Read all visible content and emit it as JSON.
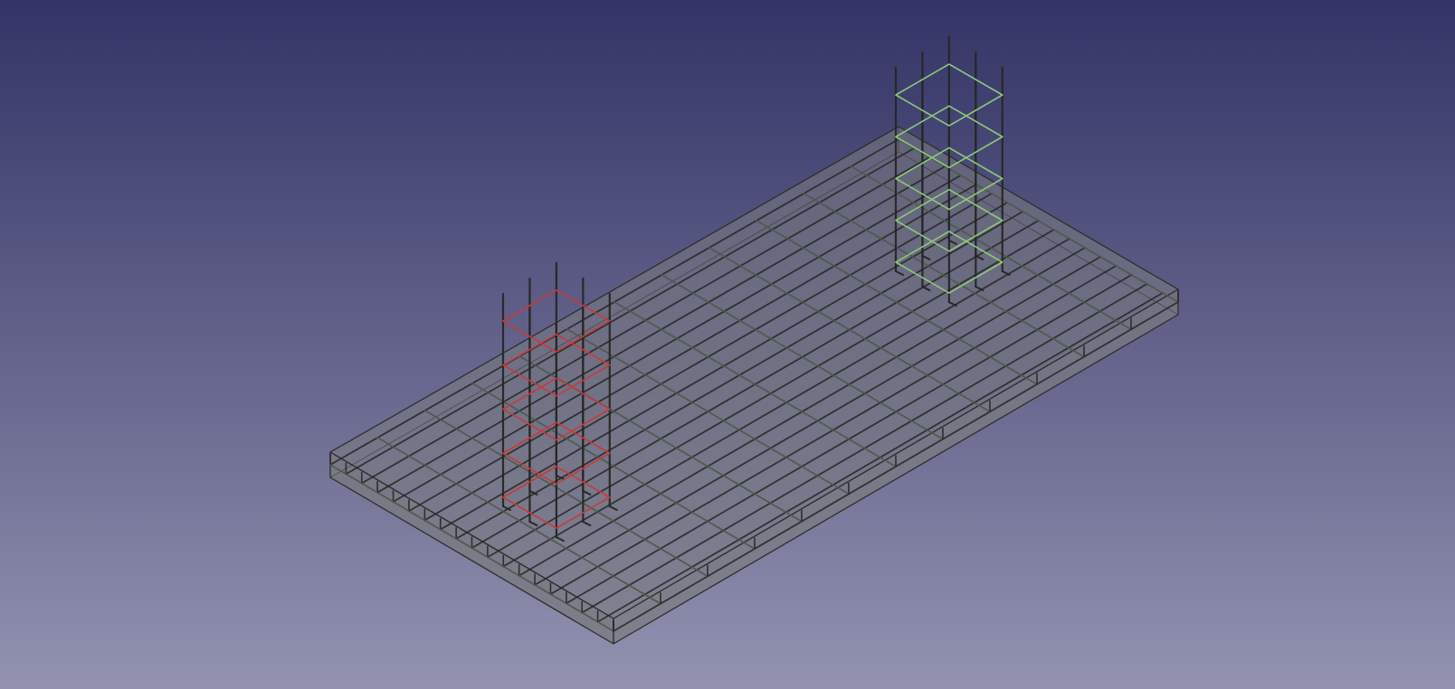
{
  "app": {
    "view": "3D view",
    "projection": "isometric"
  },
  "colors": {
    "background_top": "#333366",
    "background_bottom": "#9292b0",
    "slab_fill": "#7a7a80",
    "slab_edge": "#2e2e2e",
    "rebar_dark": "#262626",
    "rebar_mesh_tint": "#4a5a4a",
    "stirrup_red": "#c43c3c",
    "stirrup_green": "#8cc87a"
  },
  "scene": {
    "objects": [
      {
        "name": "foundation-slab",
        "kind": "slab",
        "visible_text": ""
      },
      {
        "name": "bottom-rebar-mesh",
        "kind": "rebar-mesh",
        "visible_text": ""
      },
      {
        "name": "column-cage-left",
        "kind": "column-rebar-cage",
        "stirrup_color": "red"
      },
      {
        "name": "column-cage-right",
        "kind": "column-rebar-cage",
        "stirrup_color": "green"
      }
    ]
  }
}
